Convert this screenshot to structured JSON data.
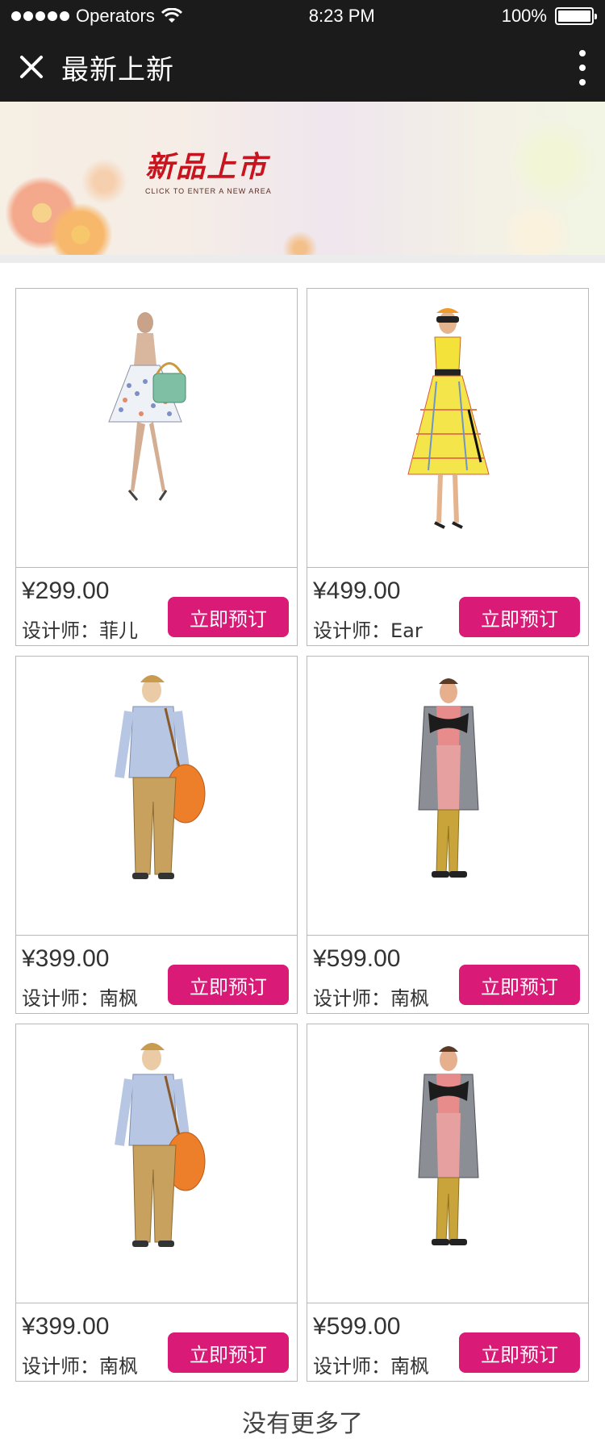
{
  "status_bar": {
    "carrier": "Operators",
    "time": "8:23 PM",
    "battery": "100%"
  },
  "nav": {
    "title": "最新上新"
  },
  "banner": {
    "title": "新品上市",
    "subtitle": "CLICK TO ENTER A NEW AREA"
  },
  "products": [
    {
      "price": "¥299.00",
      "designer": "设计师：菲儿",
      "button": "立即预订",
      "figure": "dress-floral"
    },
    {
      "price": "¥499.00",
      "designer": "设计师：Ear",
      "button": "立即预订",
      "figure": "dress-yellow"
    },
    {
      "price": "¥399.00",
      "designer": "设计师：南枫",
      "button": "立即预订",
      "figure": "man-bag"
    },
    {
      "price": "¥599.00",
      "designer": "设计师：南枫",
      "button": "立即预订",
      "figure": "man-coat"
    },
    {
      "price": "¥399.00",
      "designer": "设计师：南枫",
      "button": "立即预订",
      "figure": "man-bag"
    },
    {
      "price": "¥599.00",
      "designer": "设计师：南枫",
      "button": "立即预订",
      "figure": "man-coat"
    }
  ],
  "footer": {
    "no_more": "没有更多了"
  },
  "colors": {
    "bar_bg": "#1b1b1b",
    "accent": "#d91a77",
    "border": "#b9b9b9"
  }
}
